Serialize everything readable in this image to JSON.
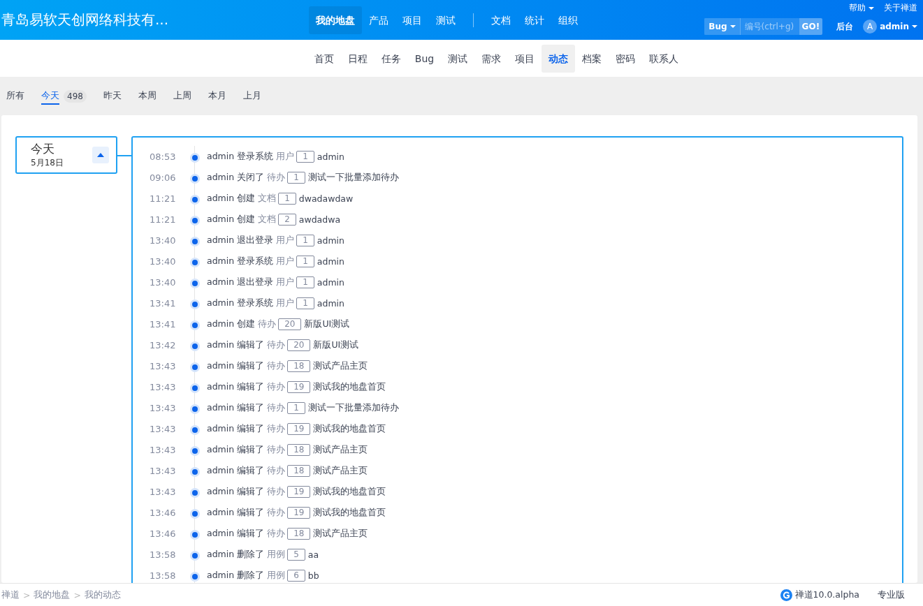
{
  "header": {
    "company": "青岛易软天创网络科技有...",
    "main_nav": [
      {
        "label": "我的地盘",
        "selected": true
      },
      {
        "label": "产品",
        "selected": false
      },
      {
        "label": "项目",
        "selected": false
      },
      {
        "label": "测试",
        "selected": false
      }
    ],
    "extra_nav": [
      {
        "label": "文档"
      },
      {
        "label": "统计"
      },
      {
        "label": "组织"
      }
    ],
    "top_links": [
      {
        "label": "帮助",
        "dropdown": true
      },
      {
        "label": "关于禅道",
        "dropdown": false
      }
    ],
    "search": {
      "type": "Bug",
      "placeholder": "编号(ctrl+g)",
      "button": "GO!"
    },
    "admin_link": "后台",
    "user": {
      "initial": "A",
      "name": "admin"
    }
  },
  "sub_nav": [
    {
      "label": "首页",
      "selected": false
    },
    {
      "label": "日程",
      "selected": false
    },
    {
      "label": "任务",
      "selected": false
    },
    {
      "label": "Bug",
      "selected": false
    },
    {
      "label": "测试",
      "selected": false
    },
    {
      "label": "需求",
      "selected": false
    },
    {
      "label": "项目",
      "selected": false
    },
    {
      "label": "动态",
      "selected": true
    },
    {
      "label": "档案",
      "selected": false
    },
    {
      "label": "密码",
      "selected": false
    },
    {
      "label": "联系人",
      "selected": false
    }
  ],
  "filters": [
    {
      "label": "所有",
      "selected": false
    },
    {
      "label": "今天",
      "selected": true,
      "count": "498"
    },
    {
      "label": "昨天",
      "selected": false
    },
    {
      "label": "本周",
      "selected": false
    },
    {
      "label": "上周",
      "selected": false
    },
    {
      "label": "本月",
      "selected": false
    },
    {
      "label": "上月",
      "selected": false
    }
  ],
  "day": {
    "title": "今天",
    "date": "5月18日",
    "expanded": true
  },
  "actions": [
    {
      "time": "08:53",
      "action": "admin 登录系统",
      "type": "用户",
      "id": "1",
      "title": "admin"
    },
    {
      "time": "09:06",
      "action": "admin 关闭了",
      "type": "待办",
      "id": "1",
      "title": "测试一下批量添加待办"
    },
    {
      "time": "11:21",
      "action": "admin 创建",
      "type": "文档",
      "id": "1",
      "title": "dwadawdaw"
    },
    {
      "time": "11:21",
      "action": "admin 创建",
      "type": "文档",
      "id": "2",
      "title": "awdadwa"
    },
    {
      "time": "13:40",
      "action": "admin 退出登录",
      "type": "用户",
      "id": "1",
      "title": "admin"
    },
    {
      "time": "13:40",
      "action": "admin 登录系统",
      "type": "用户",
      "id": "1",
      "title": "admin"
    },
    {
      "time": "13:40",
      "action": "admin 退出登录",
      "type": "用户",
      "id": "1",
      "title": "admin"
    },
    {
      "time": "13:41",
      "action": "admin 登录系统",
      "type": "用户",
      "id": "1",
      "title": "admin"
    },
    {
      "time": "13:41",
      "action": "admin 创建",
      "type": "待办",
      "id": "20",
      "title": "新版UI测试"
    },
    {
      "time": "13:42",
      "action": "admin 编辑了",
      "type": "待办",
      "id": "20",
      "title": "新版UI测试"
    },
    {
      "time": "13:43",
      "action": "admin 编辑了",
      "type": "待办",
      "id": "18",
      "title": "测试产品主页"
    },
    {
      "time": "13:43",
      "action": "admin 编辑了",
      "type": "待办",
      "id": "19",
      "title": "测试我的地盘首页"
    },
    {
      "time": "13:43",
      "action": "admin 编辑了",
      "type": "待办",
      "id": "1",
      "title": "测试一下批量添加待办"
    },
    {
      "time": "13:43",
      "action": "admin 编辑了",
      "type": "待办",
      "id": "19",
      "title": "测试我的地盘首页"
    },
    {
      "time": "13:43",
      "action": "admin 编辑了",
      "type": "待办",
      "id": "18",
      "title": "测试产品主页"
    },
    {
      "time": "13:43",
      "action": "admin 编辑了",
      "type": "待办",
      "id": "18",
      "title": "测试产品主页"
    },
    {
      "time": "13:43",
      "action": "admin 编辑了",
      "type": "待办",
      "id": "19",
      "title": "测试我的地盘首页"
    },
    {
      "time": "13:46",
      "action": "admin 编辑了",
      "type": "待办",
      "id": "19",
      "title": "测试我的地盘首页"
    },
    {
      "time": "13:46",
      "action": "admin 编辑了",
      "type": "待办",
      "id": "18",
      "title": "测试产品主页"
    },
    {
      "time": "13:58",
      "action": "admin 删除了",
      "type": "用例",
      "id": "5",
      "title": "aa"
    },
    {
      "time": "13:58",
      "action": "admin 删除了",
      "type": "用例",
      "id": "6",
      "title": "bb"
    }
  ],
  "footer": {
    "breadcrumb": [
      {
        "label": "禅道"
      },
      {
        "label": "我的地盘"
      },
      {
        "label": "我的动态"
      }
    ],
    "separator": ">",
    "version": "禅道10.0.alpha",
    "edition": "专业版"
  }
}
